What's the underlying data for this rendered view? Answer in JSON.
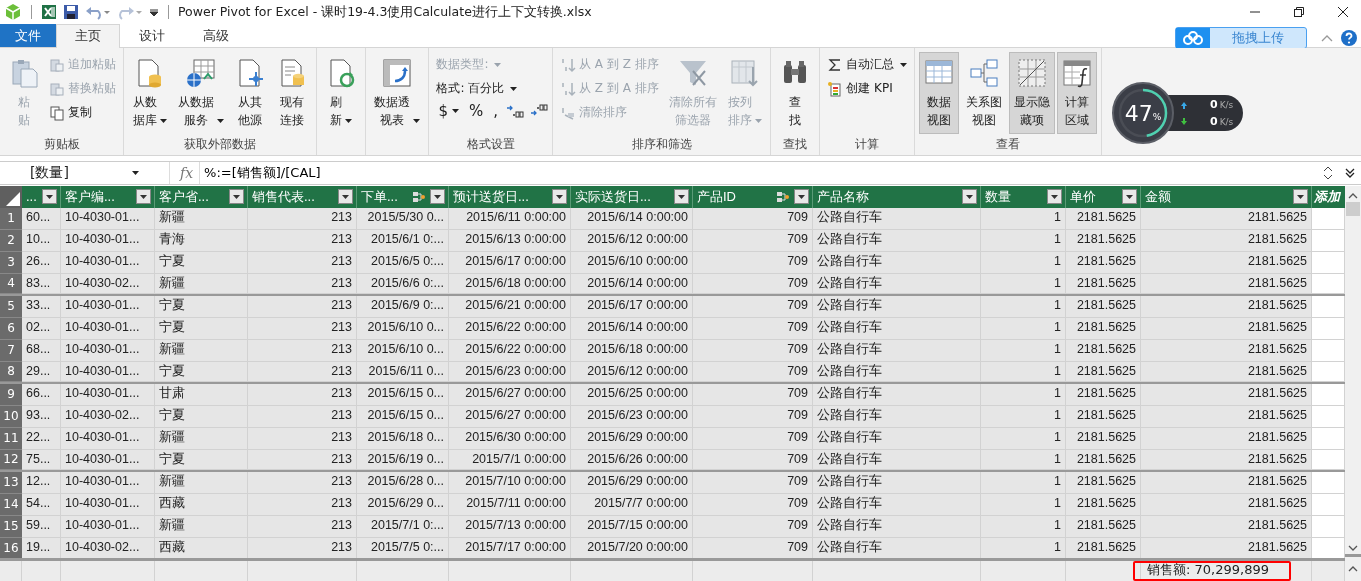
{
  "window": {
    "title": "Power Pivot for Excel - 课时19-4.3使用Calculate进行上下文转换.xlsx"
  },
  "tabs": [
    {
      "label": "文件",
      "kind": "file",
      "selected": false
    },
    {
      "label": "主页",
      "kind": "tab",
      "selected": true
    },
    {
      "label": "设计",
      "kind": "tab",
      "selected": false
    },
    {
      "label": "高级",
      "kind": "tab",
      "selected": false
    }
  ],
  "upload_button": {
    "label": "拖拽上传"
  },
  "ribbon": {
    "groups": [
      {
        "label": "剪贴板",
        "items": [
          {
            "kind": "large",
            "label": "粘贴",
            "disabled": true,
            "dropdown": false
          },
          {
            "kind": "stack",
            "entries": [
              {
                "label": "追加粘贴",
                "disabled": true,
                "dropdown": false
              },
              {
                "label": "替换粘贴",
                "disabled": true,
                "dropdown": false
              },
              {
                "label": "复制",
                "disabled": false,
                "dropdown": false
              }
            ]
          }
        ]
      },
      {
        "label": "获取外部数据",
        "items": [
          {
            "kind": "large",
            "label": "从数据库",
            "disabled": false,
            "dropdown": true
          },
          {
            "kind": "large",
            "label": "从数据服务",
            "disabled": false,
            "dropdown": true
          },
          {
            "kind": "large",
            "label": "从其他源",
            "disabled": false,
            "dropdown": false
          },
          {
            "kind": "large",
            "label": "现有连接",
            "disabled": false,
            "dropdown": false
          }
        ]
      },
      {
        "items": [
          {
            "kind": "large",
            "label": "刷新",
            "disabled": false,
            "dropdown": true
          }
        ]
      },
      {
        "items": [
          {
            "kind": "large",
            "label": "数据透视表",
            "disabled": false,
            "dropdown": true
          }
        ]
      },
      {
        "label": "格式设置",
        "items": [
          {
            "kind": "stack",
            "entries": [
              {
                "label": "数据类型:",
                "disabled": true,
                "dropdown": true
              },
              {
                "label": "格式: 百分比",
                "disabled": false,
                "dropdown": true
              },
              {
                "kind": "symbols",
                "symbols": [
                  {
                    "label": "$",
                    "dropdown": true
                  },
                  {
                    "label": "%",
                    "dropdown": false
                  },
                  {
                    "label": ",",
                    "dropdown": false
                  }
                ]
              }
            ]
          }
        ]
      },
      {
        "label": "排序和筛选",
        "items": [
          {
            "kind": "stack",
            "entries": [
              {
                "label": "从 A 到 Z 排序",
                "disabled": true,
                "dropdown": false
              },
              {
                "label": "从 Z 到 A 排序",
                "disabled": true,
                "dropdown": false
              },
              {
                "label": "清除排序",
                "disabled": true,
                "dropdown": false
              }
            ]
          },
          {
            "kind": "large",
            "label": "清除所有筛选器",
            "disabled": true,
            "dropdown": false
          },
          {
            "kind": "large",
            "label": "按列排序",
            "disabled": true,
            "dropdown": true
          }
        ]
      },
      {
        "label": "查找",
        "items": [
          {
            "kind": "large",
            "label": "查找",
            "disabled": false,
            "dropdown": false
          }
        ]
      },
      {
        "label": "计算",
        "items": [
          {
            "kind": "stack",
            "entries": [
              {
                "label": "自动汇总",
                "disabled": false,
                "dropdown": true
              },
              {
                "label": "创建 KPI",
                "disabled": false,
                "dropdown": false
              }
            ]
          }
        ]
      },
      {
        "label": "查看",
        "items": [
          {
            "kind": "large",
            "label": "数据视图",
            "disabled": false,
            "dropdown": false,
            "selected": true
          },
          {
            "kind": "large",
            "label": "关系图视图",
            "disabled": false,
            "dropdown": false,
            "selected": false
          },
          {
            "kind": "large",
            "label": "显示隐藏项",
            "disabled": false,
            "dropdown": false,
            "selected": true
          },
          {
            "kind": "large",
            "label": "计算区域",
            "disabled": false,
            "dropdown": false,
            "selected": true
          }
        ]
      }
    ]
  },
  "speed_widget": {
    "percent": "47",
    "percent_unit": "%",
    "level": 0.47,
    "upload": "0",
    "upload_unit": "K/s",
    "download": "0",
    "download_unit": "K/s"
  },
  "formula_bar": {
    "name_box": "[数量]",
    "fx_label": "fx",
    "formula": "%:=[销售额]/[CAL]"
  },
  "table": {
    "columns": [
      {
        "label": "...",
        "linked": false,
        "kind": "column"
      },
      {
        "label": "客户编...",
        "linked": false,
        "kind": "column"
      },
      {
        "label": "客户省...",
        "linked": false,
        "kind": "column"
      },
      {
        "label": "销售代表...",
        "linked": false,
        "kind": "column"
      },
      {
        "label": "下单...",
        "linked": true,
        "kind": "column"
      },
      {
        "label": "预计送货日...",
        "linked": false,
        "kind": "column"
      },
      {
        "label": "实际送货日...",
        "linked": false,
        "kind": "column"
      },
      {
        "label": "产品ID",
        "linked": true,
        "kind": "column"
      },
      {
        "label": "产品名称",
        "linked": false,
        "kind": "column"
      },
      {
        "label": "数量",
        "linked": false,
        "kind": "column"
      },
      {
        "label": "单价",
        "linked": false,
        "kind": "column"
      },
      {
        "label": "金额",
        "linked": false,
        "kind": "column"
      },
      {
        "label": "添加",
        "linked": false,
        "kind": "add"
      }
    ],
    "rows": [
      {
        "number": "1",
        "cells": [
          "60...",
          "10-4030-01...",
          "新疆",
          "213",
          "2015/5/30 0...",
          "2015/6/11 0:00:00",
          "2015/6/14 0:00:00",
          "709",
          "公路自行车",
          "1",
          "2181.5625",
          "2181.5625"
        ]
      },
      {
        "number": "2",
        "cells": [
          "10...",
          "10-4030-01...",
          "青海",
          "213",
          "2015/6/1 0:...",
          "2015/6/13 0:00:00",
          "2015/6/12 0:00:00",
          "709",
          "公路自行车",
          "1",
          "2181.5625",
          "2181.5625"
        ]
      },
      {
        "number": "3",
        "cells": [
          "26...",
          "10-4030-01...",
          "宁夏",
          "213",
          "2015/6/5 0:...",
          "2015/6/17 0:00:00",
          "2015/6/10 0:00:00",
          "709",
          "公路自行车",
          "1",
          "2181.5625",
          "2181.5625"
        ]
      },
      {
        "number": "4",
        "cells": [
          "83...",
          "10-4030-02...",
          "新疆",
          "213",
          "2015/6/6 0:...",
          "2015/6/18 0:00:00",
          "2015/6/14 0:00:00",
          "709",
          "公路自行车",
          "1",
          "2181.5625",
          "2181.5625"
        ]
      },
      {
        "number": "5",
        "cells": [
          "33...",
          "10-4030-01...",
          "宁夏",
          "213",
          "2015/6/9 0:...",
          "2015/6/21 0:00:00",
          "2015/6/17 0:00:00",
          "709",
          "公路自行车",
          "1",
          "2181.5625",
          "2181.5625"
        ]
      },
      {
        "number": "6",
        "cells": [
          "02...",
          "10-4030-01...",
          "宁夏",
          "213",
          "2015/6/10 0...",
          "2015/6/22 0:00:00",
          "2015/6/14 0:00:00",
          "709",
          "公路自行车",
          "1",
          "2181.5625",
          "2181.5625"
        ]
      },
      {
        "number": "7",
        "cells": [
          "68...",
          "10-4030-01...",
          "新疆",
          "213",
          "2015/6/10 0...",
          "2015/6/22 0:00:00",
          "2015/6/18 0:00:00",
          "709",
          "公路自行车",
          "1",
          "2181.5625",
          "2181.5625"
        ]
      },
      {
        "number": "8",
        "cells": [
          "29...",
          "10-4030-01...",
          "宁夏",
          "213",
          "2015/6/11 0...",
          "2015/6/23 0:00:00",
          "2015/6/12 0:00:00",
          "709",
          "公路自行车",
          "1",
          "2181.5625",
          "2181.5625"
        ]
      },
      {
        "number": "9",
        "cells": [
          "66...",
          "10-4030-01...",
          "甘肃",
          "213",
          "2015/6/15 0...",
          "2015/6/27 0:00:00",
          "2015/6/25 0:00:00",
          "709",
          "公路自行车",
          "1",
          "2181.5625",
          "2181.5625"
        ]
      },
      {
        "number": "10",
        "cells": [
          "93...",
          "10-4030-02...",
          "宁夏",
          "213",
          "2015/6/15 0...",
          "2015/6/27 0:00:00",
          "2015/6/23 0:00:00",
          "709",
          "公路自行车",
          "1",
          "2181.5625",
          "2181.5625"
        ]
      },
      {
        "number": "11",
        "cells": [
          "22...",
          "10-4030-01...",
          "新疆",
          "213",
          "2015/6/18 0...",
          "2015/6/30 0:00:00",
          "2015/6/29 0:00:00",
          "709",
          "公路自行车",
          "1",
          "2181.5625",
          "2181.5625"
        ]
      },
      {
        "number": "12",
        "cells": [
          "75...",
          "10-4030-01...",
          "宁夏",
          "213",
          "2015/6/19 0...",
          "2015/7/1 0:00:00",
          "2015/6/26 0:00:00",
          "709",
          "公路自行车",
          "1",
          "2181.5625",
          "2181.5625"
        ]
      },
      {
        "number": "13",
        "cells": [
          "12...",
          "10-4030-01...",
          "新疆",
          "213",
          "2015/6/28 0...",
          "2015/7/10 0:00:00",
          "2015/6/29 0:00:00",
          "709",
          "公路自行车",
          "1",
          "2181.5625",
          "2181.5625"
        ]
      },
      {
        "number": "14",
        "cells": [
          "54...",
          "10-4030-01...",
          "西藏",
          "213",
          "2015/6/29 0...",
          "2015/7/11 0:00:00",
          "2015/7/7 0:00:00",
          "709",
          "公路自行车",
          "1",
          "2181.5625",
          "2181.5625"
        ]
      },
      {
        "number": "15",
        "cells": [
          "59...",
          "10-4030-01...",
          "新疆",
          "213",
          "2015/7/1 0:...",
          "2015/7/13 0:00:00",
          "2015/7/15 0:00:00",
          "709",
          "公路自行车",
          "1",
          "2181.5625",
          "2181.5625"
        ]
      },
      {
        "number": "16",
        "cells": [
          "19...",
          "10-4030-02...",
          "西藏",
          "213",
          "2015/7/5 0:...",
          "2015/7/17 0:00:00",
          "2015/7/20 0:00:00",
          "709",
          "公路自行车",
          "1",
          "2181.5625",
          "2181.5625"
        ]
      }
    ]
  },
  "calculation_area": {
    "measure": "销售额: 70,299,899",
    "highlighted": true
  }
}
